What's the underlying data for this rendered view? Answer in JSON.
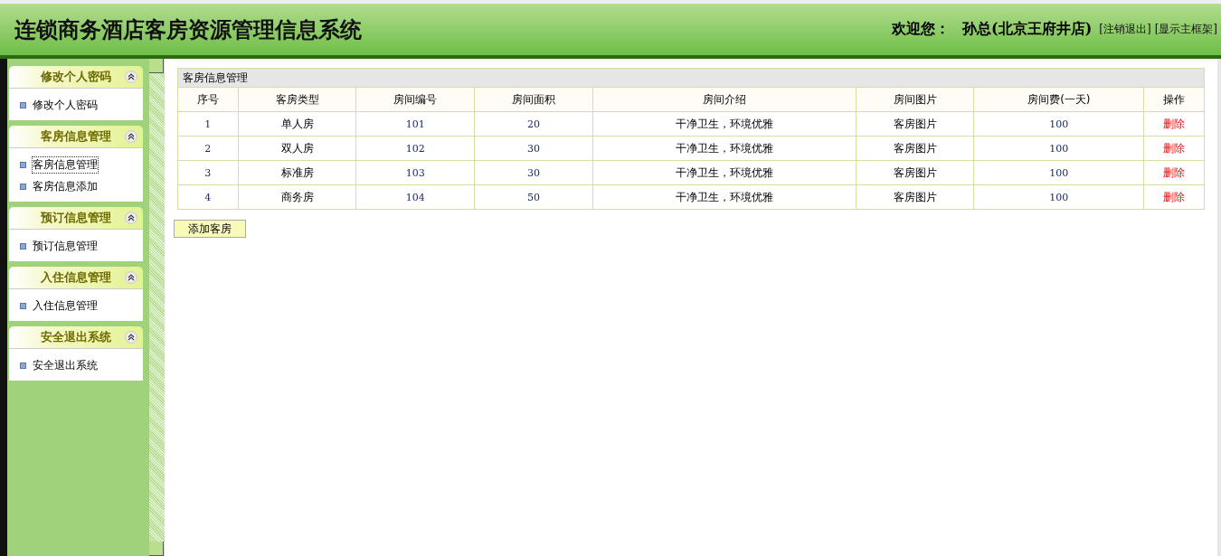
{
  "header": {
    "title": "连锁商务酒店客房资源管理信息系统",
    "welcome": "欢迎您：",
    "user": "孙总(北京王府井店)",
    "links": [
      "[注销退出]",
      "[显示主框架]"
    ]
  },
  "sidebar": {
    "groups": [
      {
        "title": "修改个人密码",
        "expanded": true,
        "items": [
          {
            "label": "修改个人密码",
            "selected": false
          }
        ]
      },
      {
        "title": "客房信息管理",
        "expanded": true,
        "items": [
          {
            "label": "客房信息管理",
            "selected": true
          },
          {
            "label": "客房信息添加",
            "selected": false
          }
        ]
      },
      {
        "title": "预订信息管理",
        "expanded": true,
        "items": [
          {
            "label": "预订信息管理",
            "selected": false
          }
        ]
      },
      {
        "title": "入住信息管理",
        "expanded": true,
        "items": [
          {
            "label": "入住信息管理",
            "selected": false
          }
        ]
      },
      {
        "title": "安全退出系统",
        "expanded": true,
        "items": [
          {
            "label": "安全退出系统",
            "selected": false
          }
        ]
      }
    ]
  },
  "table": {
    "title": "客房信息管理",
    "columns": [
      "序号",
      "客房类型",
      "房间编号",
      "房间面积",
      "房间介绍",
      "房间图片",
      "房间费(一天)",
      "操作"
    ],
    "rows": [
      {
        "cells": [
          "1",
          "单人房",
          "101",
          "20",
          "干净卫生，环境优雅",
          "客房图片",
          "100"
        ],
        "action": "删除"
      },
      {
        "cells": [
          "2",
          "双人房",
          "102",
          "30",
          "干净卫生，环境优雅",
          "客房图片",
          "100"
        ],
        "action": "删除"
      },
      {
        "cells": [
          "3",
          "标准房",
          "103",
          "30",
          "干净卫生，环境优雅",
          "客房图片",
          "100"
        ],
        "action": "删除"
      },
      {
        "cells": [
          "4",
          "商务房",
          "104",
          "50",
          "干净卫生，环境优雅",
          "客房图片",
          "100"
        ],
        "action": "删除"
      }
    ]
  },
  "add_button": "添加客房"
}
